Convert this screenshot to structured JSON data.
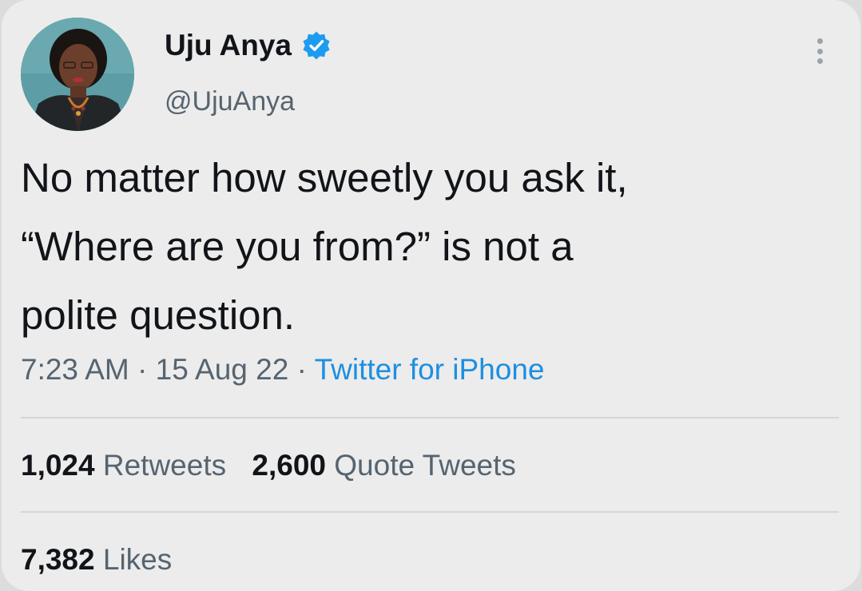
{
  "author": {
    "display_name": "Uju Anya",
    "handle": "@UjuAnya",
    "verified": true,
    "avatar": "profile-photo"
  },
  "tweet": {
    "lines": [
      "No matter how sweetly you ask it,",
      "“Where are you from?” is not a",
      "polite question."
    ],
    "time": "7:23 AM",
    "separator": "·",
    "date": "15 Aug 22",
    "source": "Twitter for iPhone"
  },
  "stats": {
    "retweets_count": "1,024",
    "retweets_label": "Retweets",
    "quotes_count": "2,600",
    "quotes_label": "Quote Tweets",
    "likes_count": "7,382",
    "likes_label": "Likes"
  },
  "colors": {
    "background": "#ececec",
    "text": "#111418",
    "secondary_text": "#566470",
    "link": "#1d8fe0",
    "verified_badge": "#1d9bf0"
  },
  "icons": {
    "verified": "verified-badge-icon",
    "more": "more-vertical-icon"
  }
}
